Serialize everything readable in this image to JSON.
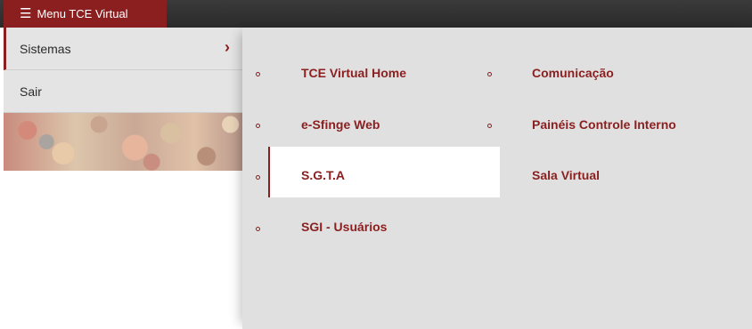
{
  "topbar": {
    "menu_label": "Menu TCE Virtual",
    "menu_icon": "hamburger-icon"
  },
  "sidebar": {
    "items": [
      {
        "label": "Sistemas",
        "icon": "chevron-right-icon"
      },
      {
        "label": "Sair"
      }
    ]
  },
  "submenu": {
    "col1": [
      "TCE Virtual Home",
      "e-Sfinge Web",
      "S.G.T.A",
      "SGI - Usuários"
    ],
    "col2": [
      "Comunicação",
      "Painéis Controle Interno",
      "Sala Virtual"
    ]
  },
  "colors": {
    "accent": "#8b1f1f",
    "topbar": "#2f2f2f",
    "panel": "#e0e0e0"
  }
}
